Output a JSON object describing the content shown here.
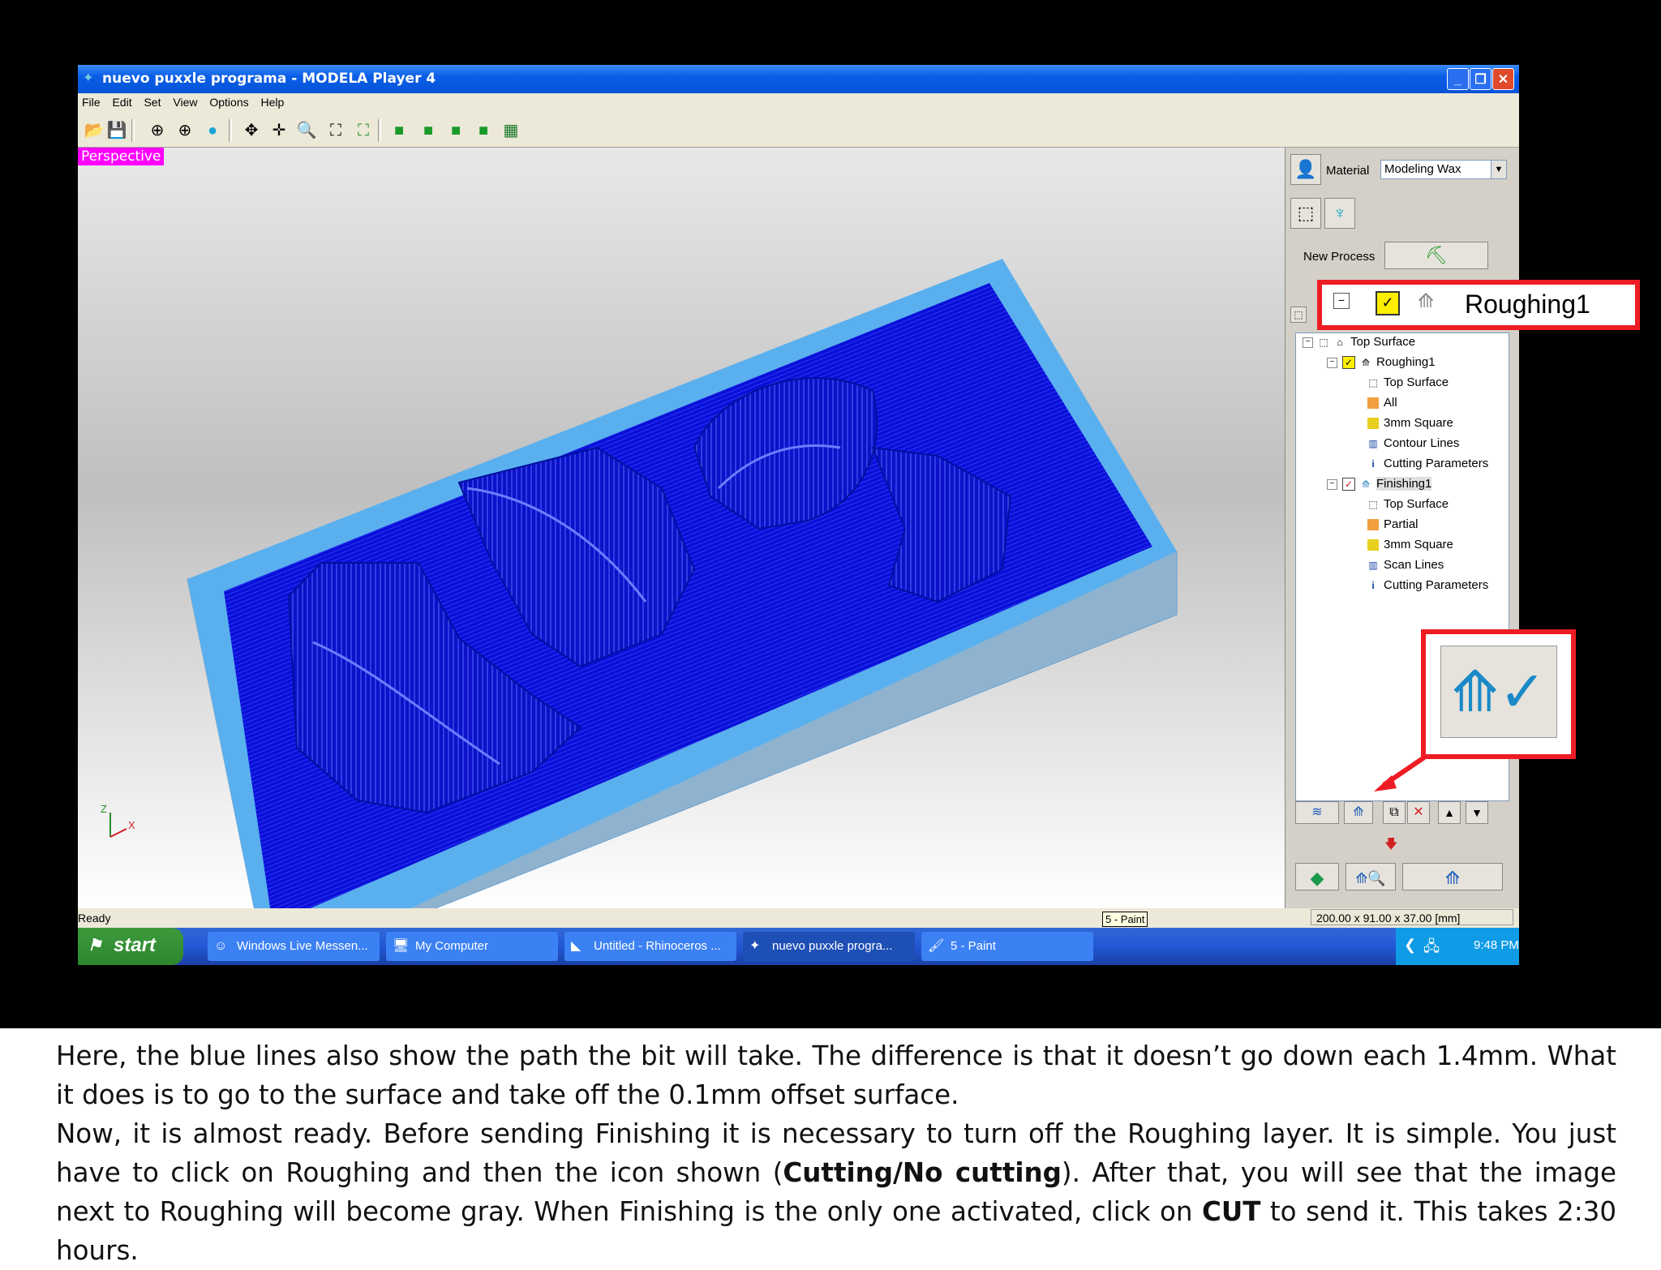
{
  "window": {
    "title": "nuevo puxxle programa - MODELA Player 4",
    "buttons": [
      "_",
      "❐",
      "✕"
    ]
  },
  "menu": [
    "File",
    "Edit",
    "Set",
    "View",
    "Options",
    "Help"
  ],
  "viewport": {
    "label": "Perspective",
    "axis_z": "Z",
    "axis_x": "X"
  },
  "panel": {
    "material_label": "Material",
    "material_value": "Modeling Wax",
    "new_process_label": "New Process",
    "callout_label": "Roughing1",
    "tree": [
      "Top Surface",
      "Roughing1",
      "Top Surface",
      "All",
      "3mm Square",
      "Contour Lines",
      "Cutting Parameters",
      "Finishing1",
      "Top Surface",
      "Partial",
      "3mm Square",
      "Scan Lines",
      "Cutting Parameters"
    ]
  },
  "status": {
    "ready": "Ready",
    "dims": "200.00 x 91.00 x 37.00 [mm]",
    "tooltip": "5 - Paint"
  },
  "taskbar": {
    "start": "start",
    "items": [
      "Windows Live Messen...",
      "My Computer",
      "Untitled - Rhinoceros ...",
      "nuevo puxxle progra...",
      "5 - Paint"
    ],
    "clock": "9:48 PM"
  },
  "caption": {
    "p1": "Here, the blue lines also show the path the bit will take. The difference is that it doesn’t go down each 1.4mm. What it does is to go to the surface and take off the 0.1mm offset surface.",
    "p2a": "Now, it is almost ready. Before sending Finishing it is necessary to turn off the Roughing layer. It is simple. You just have to click on Roughing and then the icon shown (",
    "p2b": "Cutting/No cutting",
    "p2c": "). After that, you will see that the image next to Roughing will become gray. When Finishing is the only one activated, click on ",
    "p2d": "CUT",
    "p2e": " to send it. This takes 2:30 hours."
  }
}
